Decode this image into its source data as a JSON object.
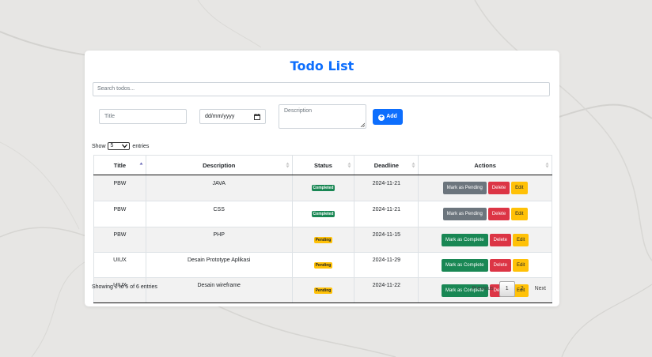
{
  "app": {
    "title": "Todo List",
    "accent_color": "#0d6efd"
  },
  "search": {
    "placeholder": "Search todos..."
  },
  "form": {
    "title_placeholder": "Title",
    "date_placeholder": "dd/mm/yyyy",
    "description_placeholder": "Description",
    "add_label": "Add",
    "add_icon": "plus-circle-icon"
  },
  "length": {
    "prefix": "Show",
    "value": "5",
    "suffix": "entries"
  },
  "table": {
    "columns": [
      "Title",
      "Description",
      "Status",
      "Deadline",
      "Actions"
    ],
    "sorted_column": "Title",
    "rows": [
      {
        "title": "PBW",
        "description": "JAVA",
        "status": "Completed",
        "deadline": "2024-11-21",
        "toggle": "Mark as Pending",
        "delete": "Delete",
        "edit": "Edit"
      },
      {
        "title": "PBW",
        "description": "CSS",
        "status": "Completed",
        "deadline": "2024-11-21",
        "toggle": "Mark as Pending",
        "delete": "Delete",
        "edit": "Edit"
      },
      {
        "title": "PBW",
        "description": "PHP",
        "status": "Pending",
        "deadline": "2024-11-15",
        "toggle": "Mark as Complete",
        "delete": "Delete",
        "edit": "Edit"
      },
      {
        "title": "UIUX",
        "description": "Desain Prototype Aplikasi",
        "status": "Pending",
        "deadline": "2024-11-29",
        "toggle": "Mark as Complete",
        "delete": "Delete",
        "edit": "Edit"
      },
      {
        "title": "UIUX",
        "description": "Desain wireframe",
        "status": "Pending",
        "deadline": "2024-11-22",
        "toggle": "Mark as Complete",
        "delete": "Delete",
        "edit": "Edit"
      }
    ]
  },
  "footer": {
    "info": "Showing 1 to 5 of 6 entries",
    "previous": "Previous",
    "pages": [
      "1",
      "2"
    ],
    "current_page": "1",
    "next": "Next"
  },
  "colors": {
    "completed": "#198754",
    "pending": "#ffc107",
    "pending_btn": "#6c757d",
    "complete_btn": "#198754",
    "delete_btn": "#dc3545",
    "edit_btn": "#ffc107"
  }
}
